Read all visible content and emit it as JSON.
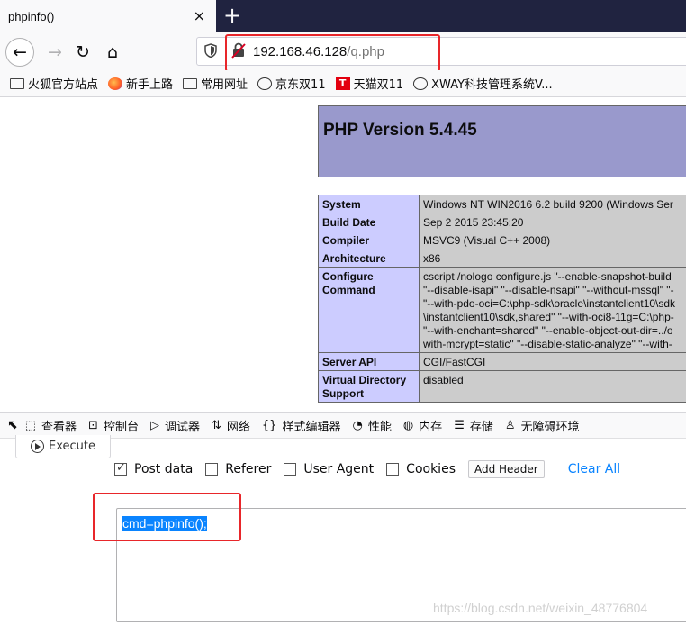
{
  "tab": {
    "title": "phpinfo()",
    "close": "×"
  },
  "newtab": "+",
  "nav": {
    "back": "←",
    "forward": "→",
    "reload": "↻",
    "home": "⌂"
  },
  "urlbar": {
    "host": "192.168.46.128",
    "path": "/q.php",
    "insecure_icon": "insecure-lock-icon"
  },
  "bookmarks": [
    {
      "label": "火狐官方站点",
      "icon": "folder-icon"
    },
    {
      "label": "新手上路",
      "icon": "firefox-icon"
    },
    {
      "label": "常用网址",
      "icon": "folder-icon"
    },
    {
      "label": "京东双11",
      "icon": "globe-icon"
    },
    {
      "label": "天猫双11",
      "icon": "tmall-icon"
    },
    {
      "label": "XWAY科技管理系统V...",
      "icon": "globe-icon"
    }
  ],
  "php": {
    "title": "PHP Version 5.4.45",
    "rows": [
      {
        "key": "System",
        "value": "Windows NT WIN2016 6.2 build 9200 (Windows Ser"
      },
      {
        "key": "Build Date",
        "value": "Sep 2 2015 23:45:20"
      },
      {
        "key": "Compiler",
        "value": "MSVC9 (Visual C++ 2008)"
      },
      {
        "key": "Architecture",
        "value": "x86"
      },
      {
        "key": "Configure Command",
        "value": "cscript /nologo configure.js \"--enable-snapshot-build\n\"--disable-isapi\" \"--disable-nsapi\" \"--without-mssql\" \"-\n\"--with-pdo-oci=C:\\php-sdk\\oracle\\instantclient10\\sdk\n\\instantclient10\\sdk,shared\" \"--with-oci8-11g=C:\\php-\n\"--with-enchant=shared\" \"--enable-object-out-dir=../o\nwith-mcrypt=static\" \"--disable-static-analyze\" \"--with-"
      },
      {
        "key": "Server API",
        "value": "CGI/FastCGI"
      },
      {
        "key": "Virtual Directory Support",
        "value": "disabled"
      }
    ]
  },
  "devtools": {
    "items": [
      {
        "label": "查看器",
        "icon": "⬚"
      },
      {
        "label": "控制台",
        "icon": "⊡"
      },
      {
        "label": "调试器",
        "icon": "▷"
      },
      {
        "label": "网络",
        "icon": "⇅"
      },
      {
        "label": "样式编辑器",
        "icon": "{}"
      },
      {
        "label": "性能",
        "icon": "◔"
      },
      {
        "label": "内存",
        "icon": "◍"
      },
      {
        "label": "存储",
        "icon": "☰"
      },
      {
        "label": "无障碍环境",
        "icon": "♙"
      }
    ]
  },
  "hackbar": {
    "execute": "Execute",
    "options": [
      {
        "label": "Post data",
        "checked": true
      },
      {
        "label": "Referer",
        "checked": false
      },
      {
        "label": "User Agent",
        "checked": false
      },
      {
        "label": "Cookies",
        "checked": false
      }
    ],
    "add_header": "Add Header",
    "clear_all": "Clear All",
    "post_body": "cmd=phpinfo();"
  },
  "watermark": "https://blog.csdn.net/weixin_48776804",
  "colors": {
    "accent": "#0a84ff",
    "annotation_red": "#e8262a",
    "php_header": "#9999cc",
    "php_key": "#ccccff",
    "php_value": "#cccccc"
  }
}
